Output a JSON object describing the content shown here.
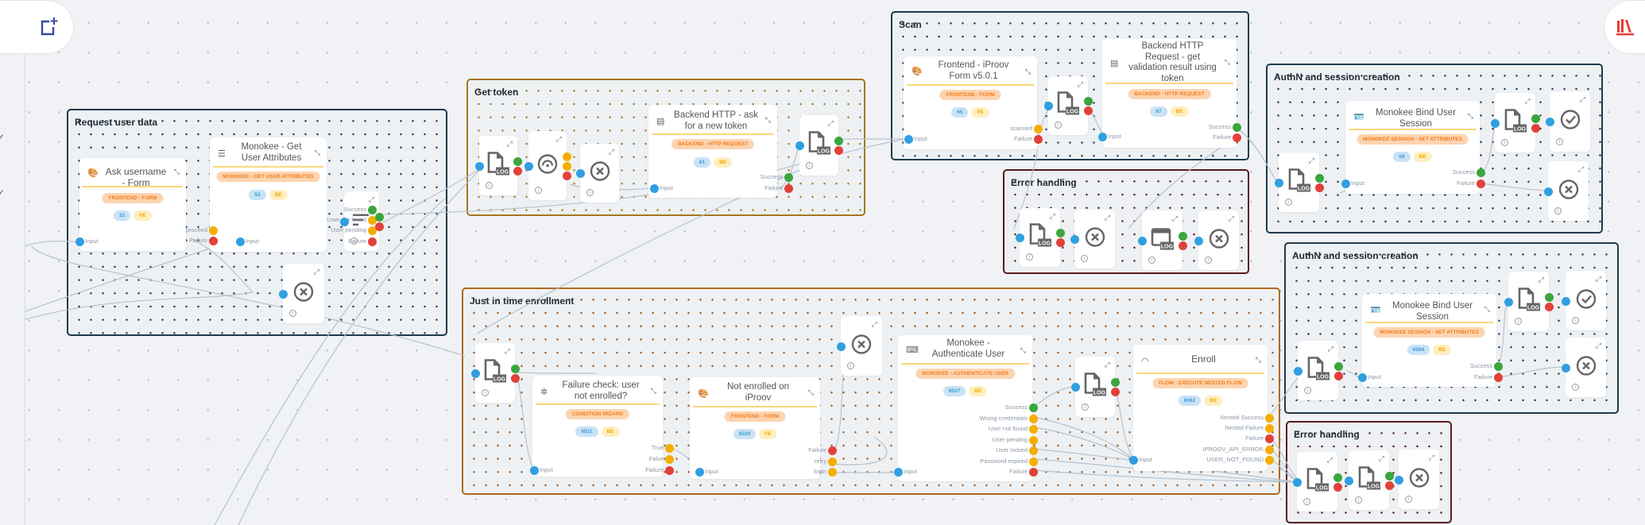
{
  "toolbar": {
    "add_button_icon": "add-node-icon",
    "library_button_icon": "library-icon",
    "accent_add": "#3b4a9c",
    "accent_library": "#e3403a"
  },
  "sidebar": {
    "check_glyphs": [
      "✓",
      "✓"
    ]
  },
  "colors": {
    "input": "#2f9fe0",
    "success": "#3aa63d",
    "warning": "#f5ae00",
    "failure": "#e3403a"
  },
  "groups": [
    {
      "id": "request-user-data",
      "title": "Request user data"
    },
    {
      "id": "get-token",
      "title": "Get token"
    },
    {
      "id": "scan",
      "title": "Scan"
    },
    {
      "id": "error-handling-1",
      "title": "Error handling"
    },
    {
      "id": "authn-1",
      "title": "AuthN and session creation"
    },
    {
      "id": "authn-2",
      "title": "AuthN and session creation"
    },
    {
      "id": "jit",
      "title": "Just in time enrollment"
    },
    {
      "id": "error-handling-2",
      "title": "Error handling"
    }
  ],
  "nodes": {
    "ask_username": {
      "title": "Ask username - Form",
      "tag": "FRONTEND - FORM",
      "id": "51",
      "type": "FE",
      "inputs": [
        "Input"
      ],
      "outputs": [
        "proceed",
        "Failure"
      ]
    },
    "get_user_attrs": {
      "title": "Monokee - Get User Attributes",
      "tag": "MONOKEE - GET USER ATTRIBUTES",
      "id": "53",
      "type": "BE",
      "inputs": [
        "Input"
      ],
      "outputs": [
        "Success",
        "User not found",
        "User pending",
        "Failure"
      ]
    },
    "http_new_token": {
      "title": "Backend HTTP - ask for a new token",
      "tag": "BACKEND - HTTP REQUEST",
      "id": "61",
      "type": "BE",
      "inputs": [
        "Input"
      ],
      "outputs": [
        "Success",
        "Failure"
      ]
    },
    "iproov_form": {
      "title": "Frontend - iProov Form v5.0.1",
      "tag": "FRONTEND - FORM",
      "id": "65",
      "type": "FE",
      "inputs": [
        "Input"
      ],
      "outputs": [
        "scanned",
        "Failure"
      ]
    },
    "http_validation": {
      "title": "Backend HTTP Request - get validation result using token",
      "tag": "BACKEND - HTTP REQUEST",
      "id": "67",
      "type": "BE",
      "inputs": [
        "Input"
      ],
      "outputs": [
        "Success",
        "Failure"
      ]
    },
    "bind_session_1": {
      "title": "Monokee Bind User Session",
      "tag": "MONOKEE SESSION - SET ATTRIBUTES",
      "id": "69",
      "type": "BE",
      "inputs": [
        "Input"
      ],
      "outputs": [
        "Success",
        "Failure"
      ]
    },
    "bind_session_2": {
      "title": "Monokee Bind User Session",
      "tag": "MONOKEE SESSION - SET ATTRIBUTES",
      "id": "6594",
      "type": "BE",
      "inputs": [
        "Input"
      ],
      "outputs": [
        "Success",
        "Failure"
      ]
    },
    "failure_check": {
      "title": "Failure check: user not enrolled?",
      "tag": "CONDITION WIZARD",
      "id": "6511",
      "type": "BE",
      "inputs": [
        "Input"
      ],
      "outputs": [
        "True",
        "False",
        "Failure"
      ]
    },
    "not_enrolled": {
      "title": "Not enrolled on iProov",
      "tag": "FRONTEND - FORM",
      "id": "6520",
      "type": "FE",
      "inputs": [
        "Input"
      ],
      "outputs": [
        "Failure",
        "retry",
        "login"
      ]
    },
    "authenticate_user": {
      "title": "Monokee - Authenticate User",
      "tag": "MONOKEE - AUTHENTICATE USER",
      "id": "6527",
      "type": "BE",
      "inputs": [
        "Input"
      ],
      "outputs": [
        "Success",
        "Wrong credentials",
        "User not found",
        "User pending",
        "User locked",
        "Password expired",
        "Failure"
      ]
    },
    "enroll": {
      "title": "Enroll",
      "tag": "FLOW - EXECUTE NESTED FLOW",
      "id": "6562",
      "type": "BE",
      "inputs": [
        "Input"
      ],
      "outputs": [
        "Nested Success",
        "Nested Failure",
        "Failure",
        "IPROOV_API_ERROR",
        "USER_NOT_FOUND"
      ]
    }
  },
  "mini_labels": {
    "log": "LOG"
  }
}
